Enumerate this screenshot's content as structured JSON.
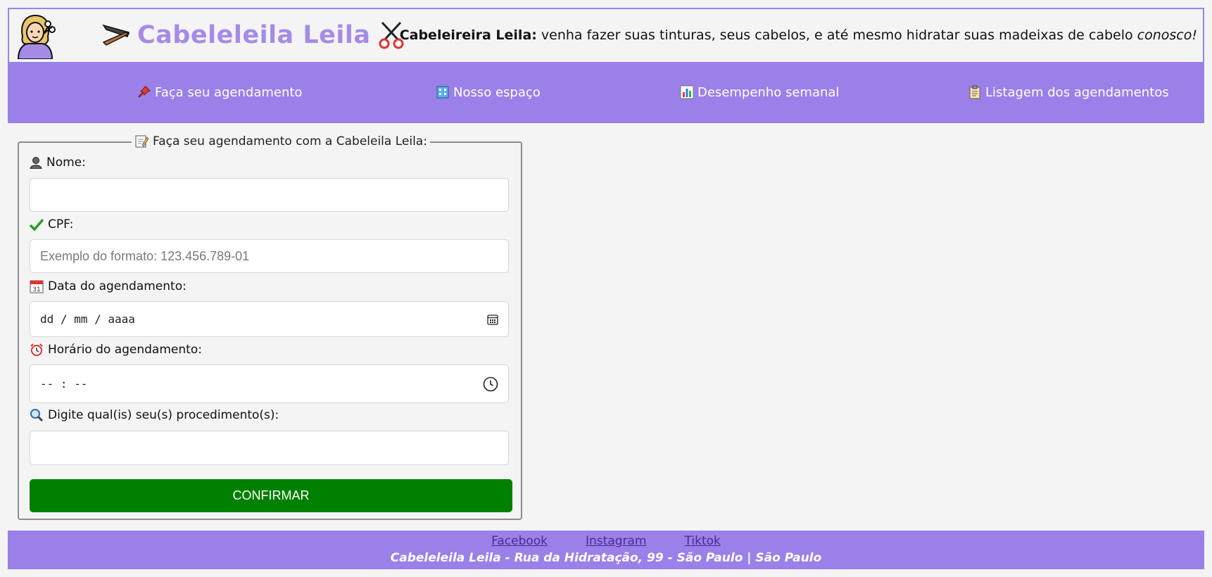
{
  "header": {
    "brand_title": "Cabeleleila Leila",
    "tagline_bold": "Cabeleireira Leila:",
    "tagline_text": " venha fazer suas tinturas, seus cabelos, e até mesmo hidratar suas madeixas de cabelo ",
    "tagline_italic": "conosco!",
    "icons": [
      "woman-hairdresser-icon",
      "razor-icon",
      "scissors-icon"
    ]
  },
  "nav": {
    "items": [
      {
        "label": "Faça seu agendamento",
        "icon": "pushpin-icon"
      },
      {
        "label": "Nosso espaço",
        "icon": "building-icon"
      },
      {
        "label": "Desempenho semanal",
        "icon": "bar-chart-icon"
      },
      {
        "label": "Listagem dos agendamentos",
        "icon": "clipboard-icon"
      }
    ]
  },
  "form": {
    "legend": "Faça seu agendamento com a Cabeleila Leila:",
    "name_label": "Nome:",
    "name_value": "",
    "cpf_label": "CPF:",
    "cpf_placeholder": "Exemplo do formato: 123.456.789-01",
    "date_label": "Data do agendamento:",
    "date_value": "dd / mm / aaaa",
    "time_label": "Horário do agendamento:",
    "time_value": "-- : --",
    "procedure_label": "Digite qual(is) seu(s) procedimento(s):",
    "procedure_value": "",
    "confirm_label": "CONFIRMAR"
  },
  "footer": {
    "links": [
      "Facebook",
      "Instagram",
      "Tiktok"
    ],
    "address": "Cabeleleila Leila - Rua da Hidratação, 99 - São Paulo | São Paulo"
  },
  "colors": {
    "accent": "#9a80e8",
    "brand_text": "#a58be6",
    "confirm": "#008000",
    "background": "#f4f4f4"
  }
}
